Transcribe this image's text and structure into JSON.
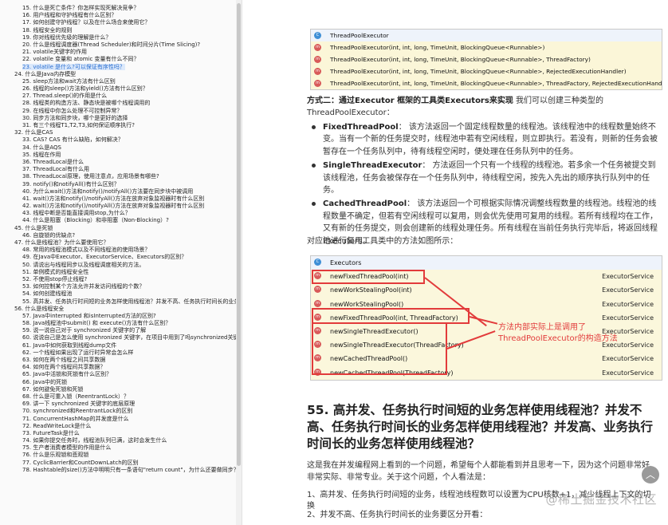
{
  "toc": {
    "items": [
      {
        "label": "15. 什么是死亡条件？你怎样实现死解决竞争？",
        "sub": true
      },
      {
        "label": "16. 用户线程和守护线程有什么区别？",
        "sub": true
      },
      {
        "label": "17. 如何创建守护线程？以及在什么场合来使用它？",
        "sub": true
      },
      {
        "label": "18. 线程安全的规则",
        "sub": true
      },
      {
        "label": "19. 你对线程优先级的理解是什么？",
        "sub": true
      },
      {
        "label": "20. 什么是线程调度器(Thread Scheduler)和时间分片(Time Slicing)?",
        "sub": true
      },
      {
        "label": "21. volatile关键字的作用",
        "sub": true
      },
      {
        "label": "22. volatile 变量和 atomic 变量有什么不同？",
        "sub": true
      },
      {
        "label": "23. volatile 是什么?可以保证有序性吗？",
        "sub": true,
        "active": true
      },
      {
        "label": "24. 什么是Java内存模型",
        "sub": false
      },
      {
        "label": "25. sleep方法和wait方法有什么区别",
        "sub": true
      },
      {
        "label": "26. 线程的sleep()方法和yield()方法有什么区别？",
        "sub": true
      },
      {
        "label": "27. Thread.sleep()的作用是什么",
        "sub": true
      },
      {
        "label": "28. 线程类的构造方法、静态块是被哪个线程调用的",
        "sub": true
      },
      {
        "label": "29. 在线程中你怎么处理不可控制异常？",
        "sub": true
      },
      {
        "label": "30. 同步方法和同步块，哪个是更好的选择",
        "sub": true
      },
      {
        "label": "31. 有三个线程T1,T2,T3,如何保证顺序执行?",
        "sub": true
      },
      {
        "label": "32. 什么是CAS",
        "sub": false
      },
      {
        "label": "33. CAS? CAS 有什么缺陷，如何解决？",
        "sub": true
      },
      {
        "label": "34. 什么是AQS",
        "sub": true
      },
      {
        "label": "35. 线程在作用",
        "sub": true
      },
      {
        "label": "36. ThreadLocal是什么",
        "sub": true
      },
      {
        "label": "37. ThreadLocal有什么用",
        "sub": true
      },
      {
        "label": "38. ThreadLocal原理，使用注意点，应用场景有哪些?",
        "sub": true
      },
      {
        "label": "39. notify()和notifyAll()有什么区别？",
        "sub": true
      },
      {
        "label": "40. 为什么wait()方法和notify()/notifyAll()方法要在同步块中被调用",
        "sub": true
      },
      {
        "label": "41. wait()方法和notify()/notifyAll()方法在放弃对象监视器时有什么区别",
        "sub": true
      },
      {
        "label": "42. wait()方法和notify()/notifyAll()方法在放弃对象监视器时有什么区别",
        "sub": true
      },
      {
        "label": "43. 线程中断是否能直接调用stop,为什么？",
        "sub": true
      },
      {
        "label": "44. 什么是阻塞（Blocking）和非阻塞（Non-Blocking）?",
        "sub": true
      },
      {
        "label": "45. 什么是死锁",
        "sub": false
      },
      {
        "label": "46. 自旋锁的优缺点?",
        "sub": true
      },
      {
        "label": "47. 什么是线程池？为什么要使用它？",
        "sub": false
      },
      {
        "label": "48. 常用的线程池模式以及不同线程池的使用场景？",
        "sub": true
      },
      {
        "label": "49. 在Java中Executor、ExecutorService、Executors的区别？",
        "sub": true
      },
      {
        "label": "50. 请说出与线程同步以及线程调度相关的方法。",
        "sub": true
      },
      {
        "label": "51. 单例模式的线程安全性",
        "sub": true
      },
      {
        "label": "52. 不使用stop停止线程?",
        "sub": true
      },
      {
        "label": "53. 如何控制某个方法允许并发访问线程的个数？",
        "sub": true
      },
      {
        "label": "54. 如何创建线程池",
        "sub": true
      },
      {
        "label": "55. 高并发、任务执行时间短的业务怎样使用线程池？并发不高、任务执行时间长的业务怎样使用线程",
        "sub": true
      },
      {
        "label": "56. 什么是线程安全",
        "sub": false
      },
      {
        "label": "57. Java中interrupted 和isInterrupted方法的区别?",
        "sub": true
      },
      {
        "label": "58. Java线程池中submit() 和 execute()方法有什么区别？",
        "sub": true
      },
      {
        "label": "59. 说一说自己对于 synchronized 关键字的了解",
        "sub": true
      },
      {
        "label": "60. 说说自己是怎么使用 synchronized 关键字，在项目中用到了吗synchronized关键字最主要的三种使用方式",
        "sub": true
      },
      {
        "label": "61. Java中如何获取到线程dump文件",
        "sub": true
      },
      {
        "label": "62. 一个线程如果出现了运行时异常会怎么样",
        "sub": true
      },
      {
        "label": "63. 如何在两个线程之间共享数据",
        "sub": true
      },
      {
        "label": "64. 如何在两个线程间共享数据？",
        "sub": true
      },
      {
        "label": "65. Java中活锁和死锁有什么区别？",
        "sub": true
      },
      {
        "label": "66. Java中的死锁",
        "sub": true
      },
      {
        "label": "67. 如何避免死锁和死锁",
        "sub": true
      },
      {
        "label": "68. 什么是可重入锁（ReentrantLock）？",
        "sub": true
      },
      {
        "label": "69. 讲一下 synchronized 关键字的底层原理",
        "sub": true
      },
      {
        "label": "70. synchronized和ReentrantLock的区别",
        "sub": true
      },
      {
        "label": "71. ConcurrentHashMap的并发度是什么",
        "sub": true
      },
      {
        "label": "72. ReadWriteLock是什么",
        "sub": true
      },
      {
        "label": "73. FutureTask是什么",
        "sub": true
      },
      {
        "label": "74. 如果你提交任务时，线程池队列已满，这时会发生什么",
        "sub": true
      },
      {
        "label": "75. 生产者消费者模型的作用是什么",
        "sub": true
      },
      {
        "label": "76. 什么是乐观锁和悲观锁",
        "sub": true
      },
      {
        "label": "77. CyclicBarrier和CountDownLatch的区别",
        "sub": true
      },
      {
        "label": "78. Hashtable的size()方法中明明只有一条语句\"return count\"，为什么还要做同步？",
        "sub": true
      }
    ]
  },
  "box1": {
    "class_name": "ThreadPoolExecutor",
    "constructors": [
      "ThreadPoolExecutor(int, int, long, TimeUnit, BlockingQueue<Runnable>)",
      "ThreadPoolExecutor(int, int, long, TimeUnit, BlockingQueue<Runnable>, ThreadFactory)",
      "ThreadPoolExecutor(int, int, long, TimeUnit, BlockingQueue<Runnable>, RejectedExecutionHandler)",
      "ThreadPoolExecutor(int, int, long, TimeUnit, BlockingQueue<Runnable>, ThreadFactory, RejectedExecutionHandler)"
    ]
  },
  "intro": {
    "bold": "方式二：通过Executor 框架的工具类Executors来实现",
    "rest": " 我们可以创建三种类型的ThreadPoolExecutor："
  },
  "bullets": [
    {
      "term": "FixedThreadPool",
      "text": "： 该方法返回一个固定线程数量的线程池。该线程池中的线程数量始终不变。当有一个新的任务提交时，线程池中若有空闲线程，则立即执行。若没有，则新的任务会被暂存在一个任务队列中，待有线程空闲时，便处理在任务队列中的任务。"
    },
    {
      "term": "SingleThreadExecutor",
      "text": "： 方法返回一个只有一个线程的线程池。若多余一个任务被提交到该线程池，任务会被保存在一个任务队列中，待线程空闲，按先入先出的顺序执行队列中的任务。"
    },
    {
      "term": "CachedThreadPool",
      "text": "： 该方法返回一个可根据实际情况调整线程数量的线程池。线程池的线程数量不确定，但若有空闲线程可以复用，则会优先使用可复用的线程。若所有线程均在工作，又有新的任务提交，则会创建新的线程处理任务。所有线程在当前任务执行完毕后，将返回线程池进行复用。"
    }
  ],
  "methods_note": "对应Executors工具类中的方法如图所示：",
  "box2": {
    "class_name": "Executors",
    "methods": [
      {
        "name": "newFixedThreadPool(int)",
        "ret": "ExecutorService"
      },
      {
        "name": "newWorkStealingPool(int)",
        "ret": "ExecutorService"
      },
      {
        "name": "newWorkStealingPool()",
        "ret": "ExecutorService"
      },
      {
        "name": "newFixedThreadPool(int, ThreadFactory)",
        "ret": "ExecutorService"
      },
      {
        "name": "newSingleThreadExecutor()",
        "ret": "ExecutorService"
      },
      {
        "name": "newSingleThreadExecutor(ThreadFactory)",
        "ret": "ExecutorService"
      },
      {
        "name": "newCachedThreadPool()",
        "ret": "ExecutorService"
      },
      {
        "name": "newCachedThreadPool(ThreadFactory)",
        "ret": "ExecutorService"
      }
    ],
    "annotation": "方法内部实际上是调用了ThreadPoolExecutor的构造方法"
  },
  "heading_55": "55. 高并发、任务执行时间短的业务怎样使用线程池？并发不高、任务执行时间长的业务怎样使用线程池？并发高、业务执行时间长的业务怎样使用线程池？",
  "prose": "这是我在并发编程网上看到的一个问题，希望每个人都能看到并且思考一下，因为这个问题非常好、非常实际、非常专业。关于这个问题，个人看法是：",
  "point1": "1、高并发、任务执行时间短的业务，线程池线程数可以设置为CPU核数+1，减少线程上下文的切换",
  "point2": "2、并发不高、任务执行时间长的业务要区分开看：",
  "watermark": "@稀土掘金技术社区",
  "colors": {
    "accent": "#2b6fd0",
    "highlight": "#e23b3b",
    "ide_bg": "#fbf6d8"
  }
}
